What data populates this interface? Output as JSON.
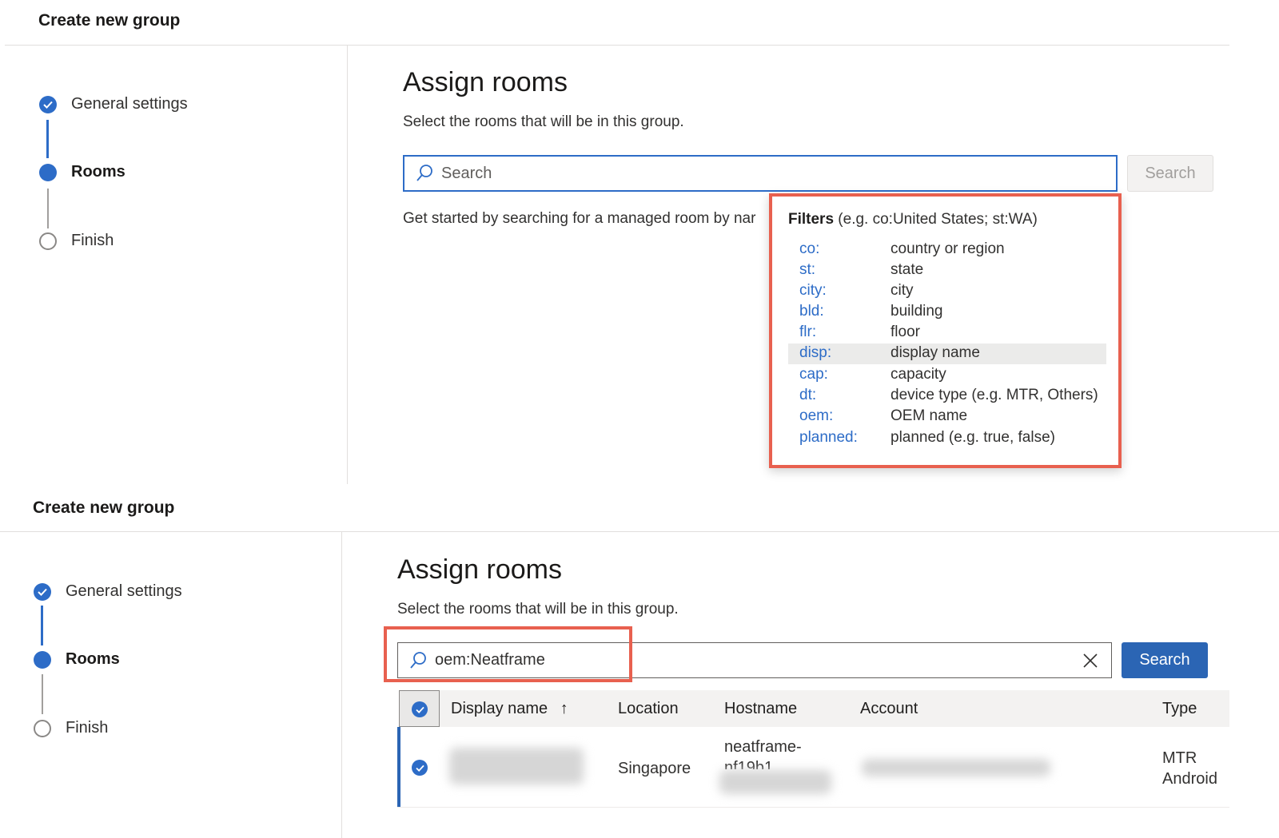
{
  "top": {
    "panel_title": "Create new group",
    "steps": [
      {
        "label": "General settings",
        "state": "done"
      },
      {
        "label": "Rooms",
        "state": "current"
      },
      {
        "label": "Finish",
        "state": "pending"
      }
    ],
    "title": "Assign rooms",
    "subtitle": "Select the rooms that will be in this group.",
    "search_placeholder": "Search",
    "search_button": "Search",
    "hint": "Get started by searching for a managed room by nar",
    "filters": {
      "header_bold": "Filters",
      "header_rest": " (e.g. co:United States; st:WA)",
      "items": [
        {
          "key": "co:",
          "desc": "country or region"
        },
        {
          "key": "st:",
          "desc": "state"
        },
        {
          "key": "city:",
          "desc": "city"
        },
        {
          "key": "bld:",
          "desc": "building"
        },
        {
          "key": "flr:",
          "desc": "floor"
        },
        {
          "key": "disp:",
          "desc": "display name"
        },
        {
          "key": "cap:",
          "desc": "capacity"
        },
        {
          "key": "dt:",
          "desc": "device type (e.g. MTR, Others)"
        },
        {
          "key": "oem:",
          "desc": "OEM name"
        },
        {
          "key": "planned:",
          "desc": "planned (e.g. true, false)"
        }
      ]
    }
  },
  "bottom": {
    "panel_title": "Create new group",
    "steps": [
      {
        "label": "General settings",
        "state": "done"
      },
      {
        "label": "Rooms",
        "state": "current"
      },
      {
        "label": "Finish",
        "state": "pending"
      }
    ],
    "title": "Assign rooms",
    "subtitle": "Select the rooms that will be in this group.",
    "search_value": "oem:Neatframe",
    "search_button": "Search",
    "table": {
      "columns": [
        "Display name",
        "Location",
        "Hostname",
        "Account",
        "Type"
      ],
      "sort_indicator": "↑",
      "rows": [
        {
          "location": "Singapore",
          "hostname_line1": "neatframe-",
          "hostname_line2": "nf19b1",
          "type_line1": "MTR",
          "type_line2": "Android"
        }
      ]
    }
  },
  "colors": {
    "accent": "#2d6cc7",
    "primary_button": "#2b65b4",
    "highlight_border": "#e8604f"
  }
}
